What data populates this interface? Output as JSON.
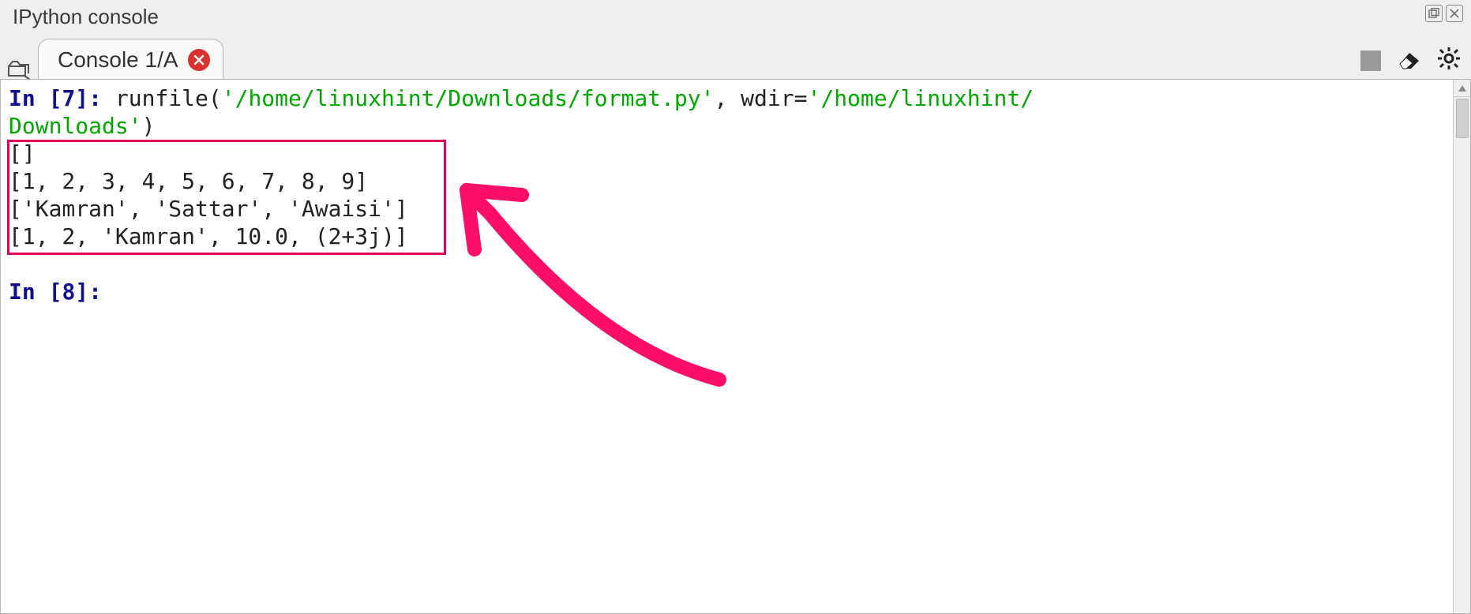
{
  "panel": {
    "title": "IPython console"
  },
  "tabs": {
    "active": {
      "label": "Console 1/A"
    }
  },
  "prompts": {
    "in7_prefix": "In [",
    "in7_num": "7",
    "in7_suffix": "]: ",
    "in8_prefix": "In [",
    "in8_num": "8",
    "in8_suffix": "]:"
  },
  "code": {
    "call1": "runfile(",
    "str1": "'/home/linuxhint/Downloads/format.py'",
    "kw1": ", wdir=",
    "str2_a": "'/home/linuxhint/",
    "str2_b": "Downloads'",
    "rparen": ")"
  },
  "output": {
    "line1": "[]",
    "line2": "[1, 2, 3, 4, 5, 6, 7, 8, 9]",
    "line3": "['Kamran', 'Sattar', 'Awaisi']",
    "line4": "[1, 2, 'Kamran', 10.0, (2+3j)]"
  }
}
